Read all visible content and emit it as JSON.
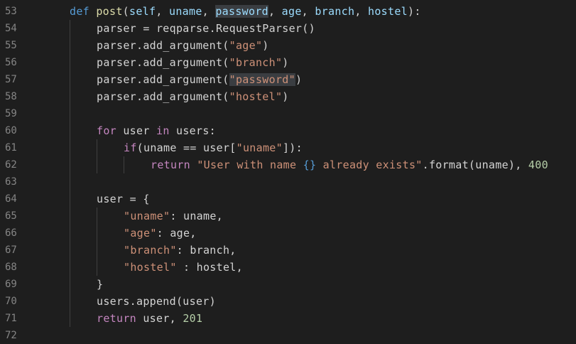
{
  "editor": {
    "lines": [
      {
        "n": "53",
        "indent": 1,
        "tokens": [
          {
            "t": "def",
            "c": "kw"
          },
          {
            "t": " ",
            "c": "plain"
          },
          {
            "t": "post",
            "c": "fn"
          },
          {
            "t": "(",
            "c": "plain"
          },
          {
            "t": "self",
            "c": "param"
          },
          {
            "t": ", ",
            "c": "plain"
          },
          {
            "t": "uname",
            "c": "param"
          },
          {
            "t": ", ",
            "c": "plain"
          },
          {
            "t": "password",
            "c": "param hl"
          },
          {
            "t": ", ",
            "c": "plain"
          },
          {
            "t": "age",
            "c": "param"
          },
          {
            "t": ", ",
            "c": "plain"
          },
          {
            "t": "branch",
            "c": "param"
          },
          {
            "t": ", ",
            "c": "plain"
          },
          {
            "t": "hostel",
            "c": "param"
          },
          {
            "t": "):",
            "c": "plain"
          }
        ]
      },
      {
        "n": "54",
        "indent": 2,
        "tokens": [
          {
            "t": "parser = reqparse.RequestParser()",
            "c": "plain"
          }
        ]
      },
      {
        "n": "55",
        "indent": 2,
        "tokens": [
          {
            "t": "parser.add_argument(",
            "c": "plain"
          },
          {
            "t": "\"age\"",
            "c": "str"
          },
          {
            "t": ")",
            "c": "plain"
          }
        ]
      },
      {
        "n": "56",
        "indent": 2,
        "tokens": [
          {
            "t": "parser.add_argument(",
            "c": "plain"
          },
          {
            "t": "\"branch\"",
            "c": "str"
          },
          {
            "t": ")",
            "c": "plain"
          }
        ]
      },
      {
        "n": "57",
        "indent": 2,
        "tokens": [
          {
            "t": "parser.add_argument(",
            "c": "plain"
          },
          {
            "t": "\"password\"",
            "c": "str hl"
          },
          {
            "t": ")",
            "c": "plain"
          }
        ]
      },
      {
        "n": "58",
        "indent": 2,
        "tokens": [
          {
            "t": "parser.add_argument(",
            "c": "plain"
          },
          {
            "t": "\"hostel\"",
            "c": "str"
          },
          {
            "t": ")",
            "c": "plain"
          }
        ]
      },
      {
        "n": "59",
        "indent": 2,
        "tokens": []
      },
      {
        "n": "60",
        "indent": 2,
        "tokens": [
          {
            "t": "for",
            "c": "ctl"
          },
          {
            "t": " user ",
            "c": "plain"
          },
          {
            "t": "in",
            "c": "ctl"
          },
          {
            "t": " users:",
            "c": "plain"
          }
        ]
      },
      {
        "n": "61",
        "indent": 3,
        "tokens": [
          {
            "t": "if",
            "c": "ctl"
          },
          {
            "t": "(uname == user[",
            "c": "plain"
          },
          {
            "t": "\"uname\"",
            "c": "str"
          },
          {
            "t": "]):",
            "c": "plain"
          }
        ]
      },
      {
        "n": "62",
        "indent": 4,
        "tokens": [
          {
            "t": "return",
            "c": "ctl"
          },
          {
            "t": " ",
            "c": "plain"
          },
          {
            "t": "\"User with name ",
            "c": "str"
          },
          {
            "t": "{}",
            "c": "fmt"
          },
          {
            "t": " already exists\"",
            "c": "str"
          },
          {
            "t": ".format(uname), ",
            "c": "plain"
          },
          {
            "t": "400",
            "c": "num"
          }
        ]
      },
      {
        "n": "63",
        "indent": 2,
        "tokens": []
      },
      {
        "n": "64",
        "indent": 2,
        "tokens": [
          {
            "t": "user = {",
            "c": "plain"
          }
        ]
      },
      {
        "n": "65",
        "indent": 3,
        "tokens": [
          {
            "t": "\"uname\"",
            "c": "str"
          },
          {
            "t": ": uname,",
            "c": "plain"
          }
        ]
      },
      {
        "n": "66",
        "indent": 3,
        "tokens": [
          {
            "t": "\"age\"",
            "c": "str"
          },
          {
            "t": ": age,",
            "c": "plain"
          }
        ]
      },
      {
        "n": "67",
        "indent": 3,
        "tokens": [
          {
            "t": "\"branch\"",
            "c": "str"
          },
          {
            "t": ": branch,",
            "c": "plain"
          }
        ]
      },
      {
        "n": "68",
        "indent": 3,
        "tokens": [
          {
            "t": "\"hostel\"",
            "c": "str"
          },
          {
            "t": " : hostel,",
            "c": "plain"
          }
        ]
      },
      {
        "n": "69",
        "indent": 2,
        "tokens": [
          {
            "t": "}",
            "c": "plain"
          }
        ]
      },
      {
        "n": "70",
        "indent": 2,
        "tokens": [
          {
            "t": "users.append(user)",
            "c": "plain"
          }
        ]
      },
      {
        "n": "71",
        "indent": 2,
        "tokens": [
          {
            "t": "return",
            "c": "ctl"
          },
          {
            "t": " user, ",
            "c": "plain"
          },
          {
            "t": "201",
            "c": "num"
          }
        ]
      },
      {
        "n": "72",
        "indent": 1,
        "tokens": []
      }
    ]
  }
}
